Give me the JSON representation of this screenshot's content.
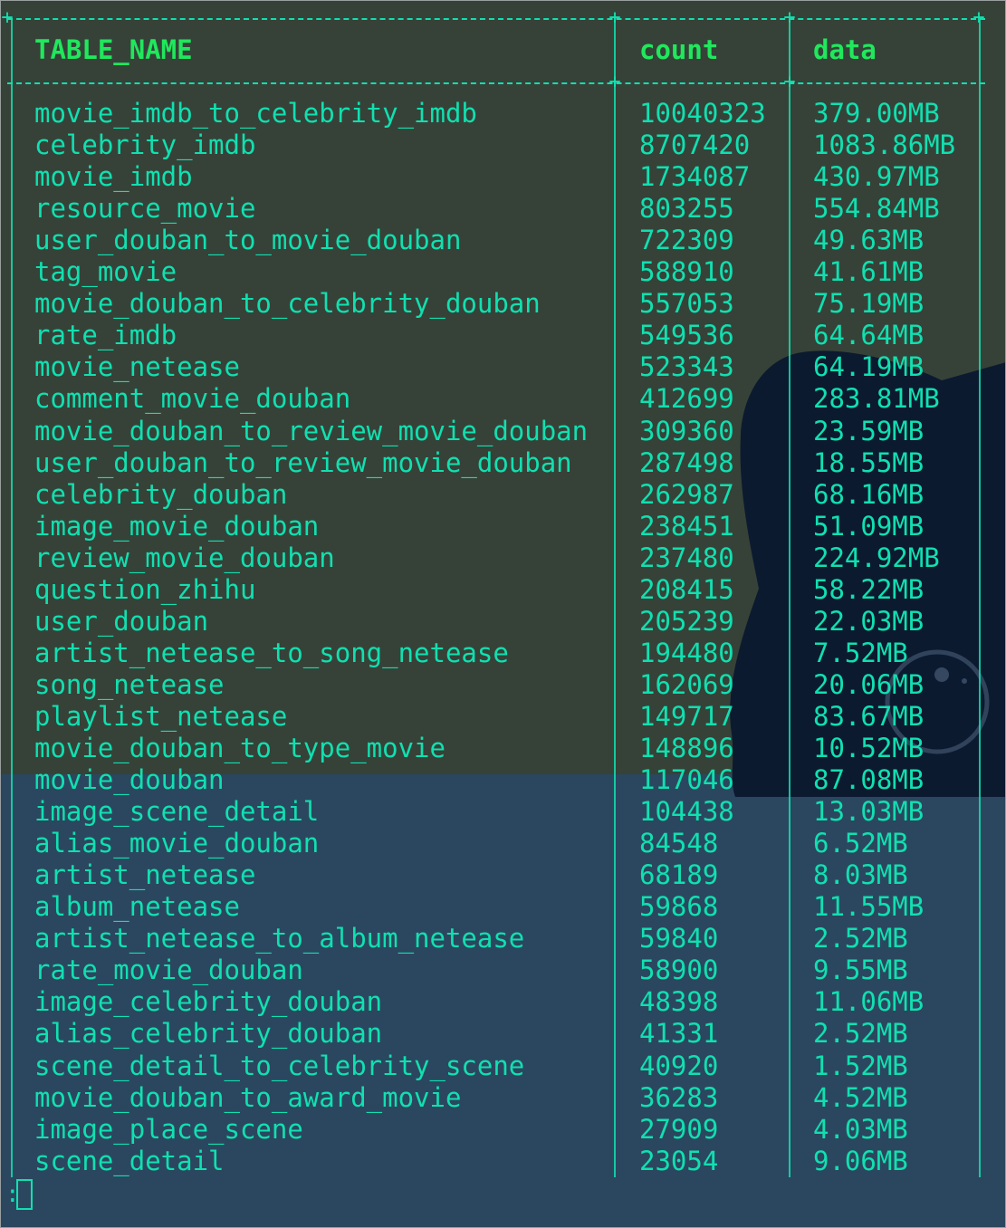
{
  "table": {
    "headers": {
      "name": "TABLE_NAME",
      "count": "count",
      "data": "data"
    },
    "rows": [
      {
        "name": "movie_imdb_to_celebrity_imdb",
        "count": "10040323",
        "data": "379.00MB"
      },
      {
        "name": "celebrity_imdb",
        "count": "8707420",
        "data": "1083.86MB"
      },
      {
        "name": "movie_imdb",
        "count": "1734087",
        "data": "430.97MB"
      },
      {
        "name": "resource_movie",
        "count": "803255",
        "data": "554.84MB"
      },
      {
        "name": "user_douban_to_movie_douban",
        "count": "722309",
        "data": "49.63MB"
      },
      {
        "name": "tag_movie",
        "count": "588910",
        "data": "41.61MB"
      },
      {
        "name": "movie_douban_to_celebrity_douban",
        "count": "557053",
        "data": "75.19MB"
      },
      {
        "name": "rate_imdb",
        "count": "549536",
        "data": "64.64MB"
      },
      {
        "name": "movie_netease",
        "count": "523343",
        "data": "64.19MB"
      },
      {
        "name": "comment_movie_douban",
        "count": "412699",
        "data": "283.81MB"
      },
      {
        "name": "movie_douban_to_review_movie_douban",
        "count": "309360",
        "data": "23.59MB"
      },
      {
        "name": "user_douban_to_review_movie_douban",
        "count": "287498",
        "data": "18.55MB"
      },
      {
        "name": "celebrity_douban",
        "count": "262987",
        "data": "68.16MB"
      },
      {
        "name": "image_movie_douban",
        "count": "238451",
        "data": "51.09MB"
      },
      {
        "name": "review_movie_douban",
        "count": "237480",
        "data": "224.92MB"
      },
      {
        "name": "question_zhihu",
        "count": "208415",
        "data": "58.22MB"
      },
      {
        "name": "user_douban",
        "count": "205239",
        "data": "22.03MB"
      },
      {
        "name": "artist_netease_to_song_netease",
        "count": "194480",
        "data": "7.52MB"
      },
      {
        "name": "song_netease",
        "count": "162069",
        "data": "20.06MB"
      },
      {
        "name": "playlist_netease",
        "count": "149717",
        "data": "83.67MB"
      },
      {
        "name": "movie_douban_to_type_movie",
        "count": "148896",
        "data": "10.52MB"
      },
      {
        "name": "movie_douban",
        "count": "117046",
        "data": "87.08MB"
      },
      {
        "name": "image_scene_detail",
        "count": "104438",
        "data": "13.03MB"
      },
      {
        "name": "alias_movie_douban",
        "count": "84548",
        "data": "6.52MB"
      },
      {
        "name": "artist_netease",
        "count": "68189",
        "data": "8.03MB"
      },
      {
        "name": "album_netease",
        "count": "59868",
        "data": "11.55MB"
      },
      {
        "name": "artist_netease_to_album_netease",
        "count": "59840",
        "data": "2.52MB"
      },
      {
        "name": "rate_movie_douban",
        "count": "58900",
        "data": "9.55MB"
      },
      {
        "name": "image_celebrity_douban",
        "count": "48398",
        "data": "11.06MB"
      },
      {
        "name": "alias_celebrity_douban",
        "count": "41331",
        "data": "2.52MB"
      },
      {
        "name": "scene_detail_to_celebrity_scene",
        "count": "40920",
        "data": "1.52MB"
      },
      {
        "name": "movie_douban_to_award_movie",
        "count": "36283",
        "data": "4.52MB"
      },
      {
        "name": "image_place_scene",
        "count": "27909",
        "data": "4.03MB"
      },
      {
        "name": "scene_detail",
        "count": "23054",
        "data": "9.06MB"
      }
    ]
  },
  "prompt": {
    "symbol": ":"
  },
  "colors": {
    "text": "#10e0b0",
    "header": "#1fe85c",
    "bg_top": "#364238",
    "bg_bottom": "#2b475f",
    "silhouette": "#0c1a30"
  }
}
